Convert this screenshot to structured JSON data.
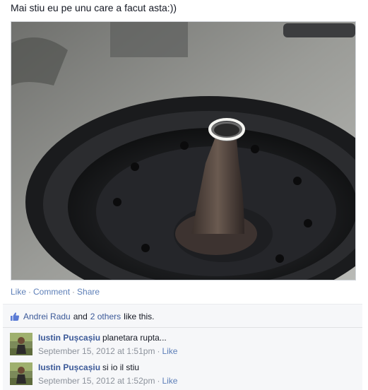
{
  "post": {
    "text": "Mai stiu eu pe unu care a facut asta:))"
  },
  "actions": {
    "like": "Like",
    "comment": "Comment",
    "share": "Share",
    "separator": "·"
  },
  "likes": {
    "name": "Andrei Radu",
    "conjunction": "and",
    "others": "2 others",
    "suffix": "like this.",
    "icon": "thumbs-up-icon"
  },
  "comments": [
    {
      "author": "Iustin Pușcașiu",
      "text": "planetara rupta...",
      "timestamp": "September 15, 2012 at 1:51pm",
      "like": "Like"
    },
    {
      "author": "Iustin Pușcașiu",
      "text": "si io il stiu",
      "timestamp": "September 15, 2012 at 1:52pm",
      "like": "Like"
    }
  ],
  "colors": {
    "link": "#3b5998",
    "action_link": "#5d7fb8",
    "meta": "#8c929b",
    "ufi_background": "#f6f7f9"
  }
}
